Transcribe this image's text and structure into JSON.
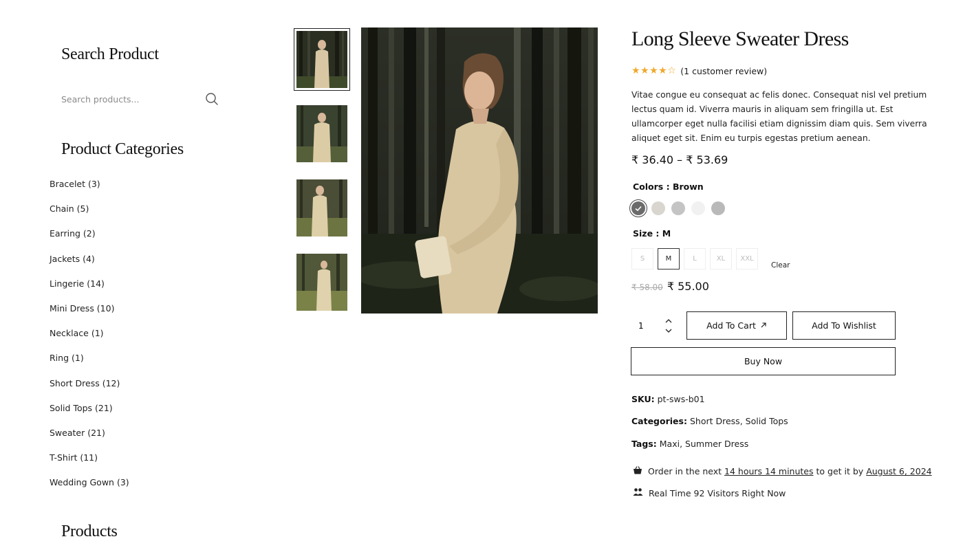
{
  "sidebar": {
    "search_title": "Search Product",
    "search_placeholder": "Search products...",
    "categories_title": "Product Categories",
    "categories": [
      "Bracelet (3)",
      "Chain (5)",
      "Earring (2)",
      "Jackets (4)",
      "Lingerie (14)",
      "Mini Dress (10)",
      "Necklace (1)",
      "Ring (1)",
      "Short Dress (12)",
      "Solid Tops (21)",
      "Sweater (21)",
      "T-Shirt (11)",
      "Wedding Gown (3)"
    ],
    "products_title": "Products"
  },
  "product": {
    "title": "Long Sleeve Sweater Dress",
    "stars": "★★★★☆",
    "rating_value": 4,
    "review_text": "(1 customer review)",
    "description": "Vitae congue eu consequat ac felis donec. Consequat nisl vel pretium lectus quam id. Viverra mauris in aliquam sem fringilla ut. Est ullamcorper eget nulla facilisi etiam dignissim diam quis. Sem viverra aliquet eget sit. Enim eu turpis egestas pretium aenean.",
    "price_range": "₹ 36.40 – ₹ 53.69",
    "colors_label": "Colors :",
    "colors_value": "Brown",
    "size_label": "Size :",
    "size_value": "M",
    "sizes": [
      "S",
      "M",
      "L",
      "XL",
      "XXL"
    ],
    "clear_label": "Clear",
    "old_price": "₹ 58.00",
    "new_price": "₹ 55.00",
    "quantity": "1",
    "add_to_cart_label": "Add To Cart",
    "add_to_wishlist_label": "Add To Wishlist",
    "buy_now_label": "Buy Now",
    "sku_label": "SKU:",
    "sku_value": "pt-sws-b01",
    "categories_label": "Categories:",
    "categories_value_1": "Short Dress",
    "categories_value_2": "Solid Tops",
    "tags_label": "Tags:",
    "tags_value_1": "Maxi",
    "tags_value_2": "Summer Dress",
    "order_prefix": "Order in the next",
    "order_time": "14 hours 14 minutes",
    "order_middle": "to get it by",
    "order_date": "August 6, 2024",
    "visitors_prefix": "Real Time",
    "visitors_count": "92",
    "visitors_suffix": "Visitors Right Now"
  },
  "colors": {
    "swatches": [
      "#6b6b6b",
      "#d9d6cf",
      "#c4c4c4",
      "#f1f1f1",
      "#b9b9b9"
    ],
    "star": "#f0a82a",
    "accent": "#111111"
  },
  "icons": {
    "search": "search-icon",
    "arrow": "arrow-up-right-icon",
    "basket": "basket-icon",
    "users": "users-icon"
  }
}
